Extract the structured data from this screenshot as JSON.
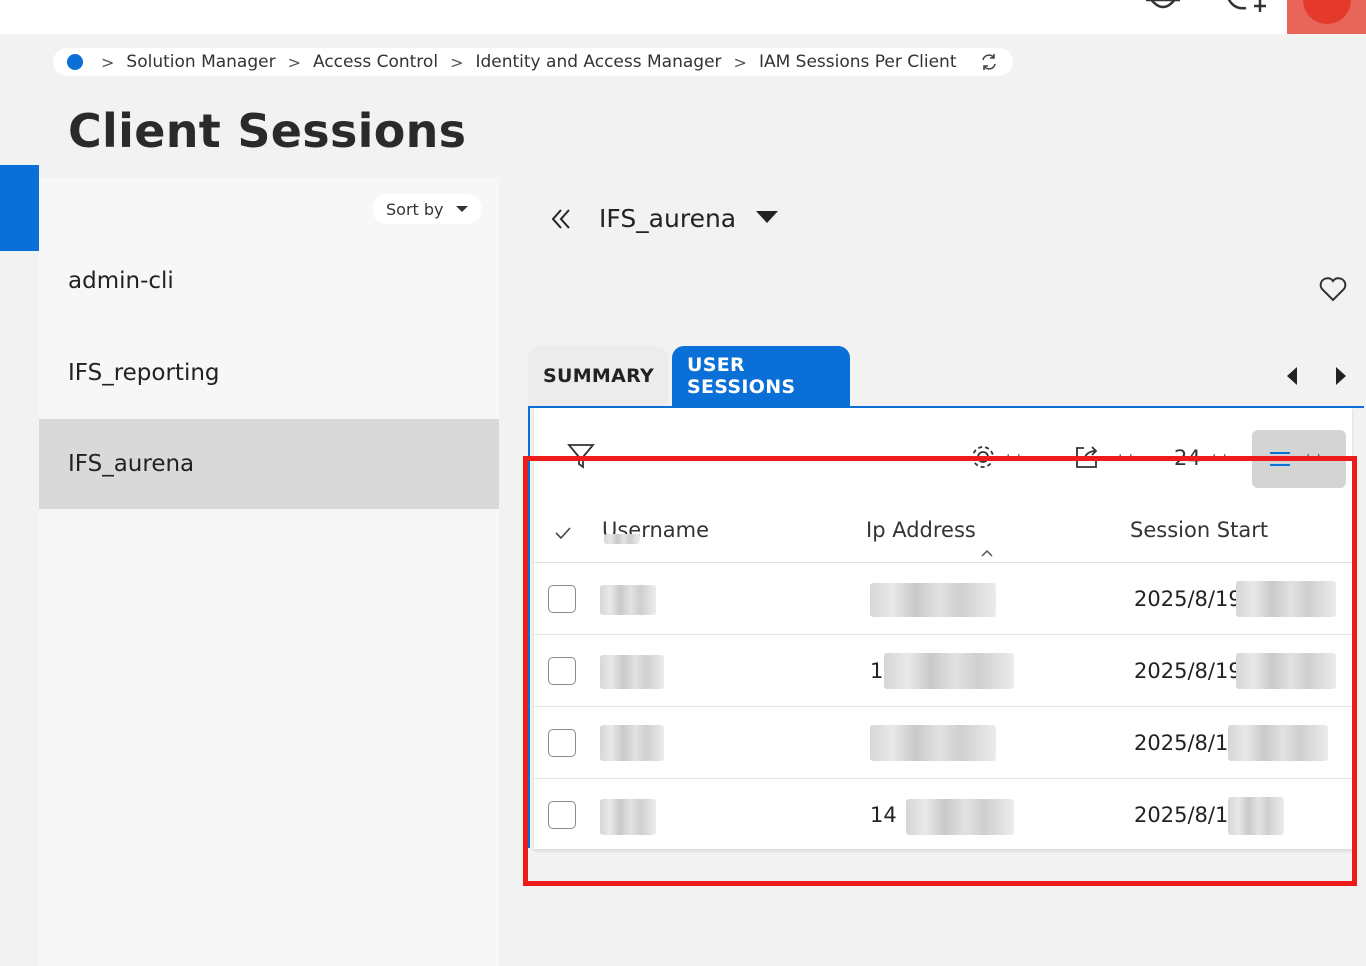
{
  "header": {
    "icons": {
      "notifications": "bell-icon",
      "add_time": "clock-plus-icon"
    }
  },
  "breadcrumb": {
    "items": [
      "Solution Manager",
      "Access Control",
      "Identity and Access Manager",
      "IAM Sessions Per Client"
    ],
    "separator": ">"
  },
  "page": {
    "title": "Client Sessions"
  },
  "list": {
    "sort_label": "Sort by",
    "items": [
      "admin-cli",
      "IFS_reporting",
      "IFS_aurena"
    ],
    "selected_index": 2
  },
  "detail": {
    "record_title": "IFS_aurena",
    "tabs": [
      "SUMMARY",
      "USER SESSIONS"
    ],
    "active_tab": "USER SESSIONS"
  },
  "grid": {
    "count_label": "24",
    "columns": [
      "Username",
      "Ip Address",
      "Session Start"
    ],
    "rows": [
      {
        "username": "",
        "ip": "",
        "session_start": "2025/8/19"
      },
      {
        "username": "",
        "ip": "1",
        "session_start": "2025/8/19"
      },
      {
        "username": "",
        "ip": "",
        "session_start": "2025/8/1"
      },
      {
        "username": "",
        "ip": "14",
        "session_start": "2025/8/1"
      }
    ]
  },
  "colors": {
    "accent": "#0a6fd6",
    "highlight": "#ee1b1b",
    "avatar": "#e53a2b"
  }
}
